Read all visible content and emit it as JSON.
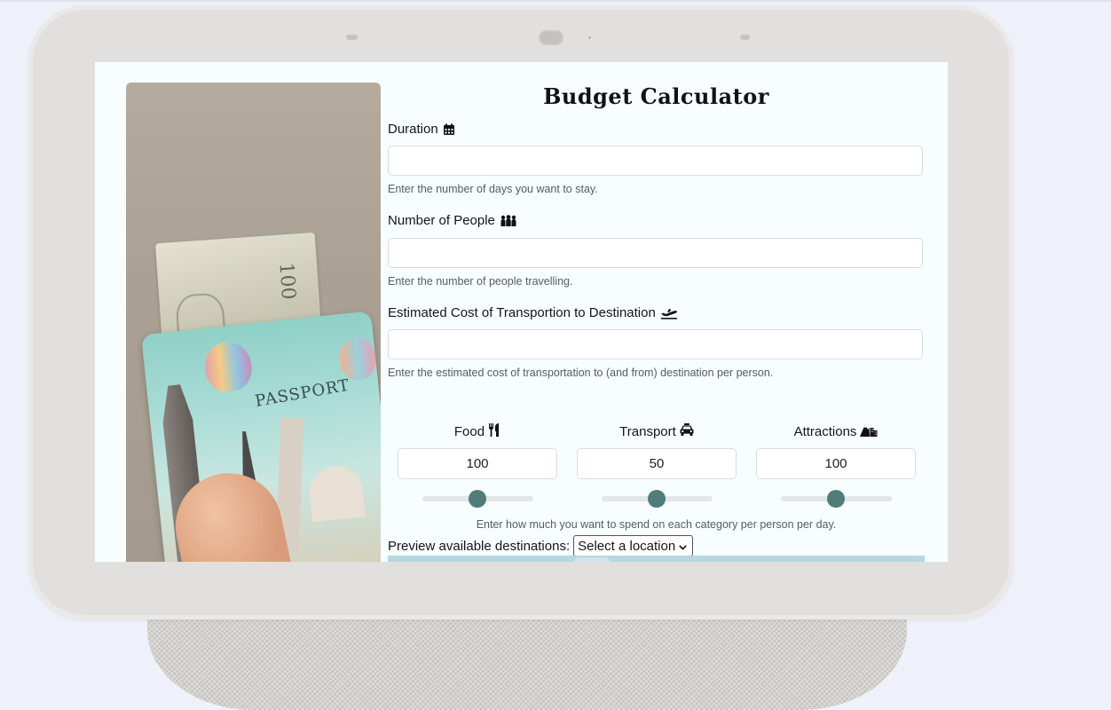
{
  "title": "Budget Calculator",
  "fields": {
    "duration": {
      "label": "Duration",
      "value": "",
      "help": "Enter the number of days you want to stay."
    },
    "people": {
      "label": "Number of People",
      "value": "",
      "help": "Enter the number of people travelling."
    },
    "transport_cost": {
      "label": "Estimated Cost of Transportion to Destination",
      "value": "",
      "help": "Enter the estimated cost of transportation to (and from) destination per person."
    }
  },
  "categories": {
    "food": {
      "label": "Food",
      "value": "100",
      "slider_fraction": 0.5
    },
    "transport": {
      "label": "Transport",
      "value": "50",
      "slider_fraction": 0.5
    },
    "attractions": {
      "label": "Attractions",
      "value": "100",
      "slider_fraction": 0.5
    }
  },
  "categories_help": "Enter how much you want to spend on each category per person per day.",
  "preview": {
    "label": "Preview available destinations:",
    "selected": "Select a location"
  },
  "photo": {
    "passport_text": "PASSPORT"
  },
  "colors": {
    "slider_thumb": "#507c79",
    "screen_bg": "#f8fdff",
    "device_frame": "#e2e0de"
  },
  "icons": {
    "duration": "calendar-icon",
    "people": "people-group-icon",
    "transport_cost": "plane-departure-icon",
    "food": "utensils-icon",
    "transport": "taxi-icon",
    "attractions": "mountain-city-icon",
    "select": "chevron-down-icon"
  }
}
